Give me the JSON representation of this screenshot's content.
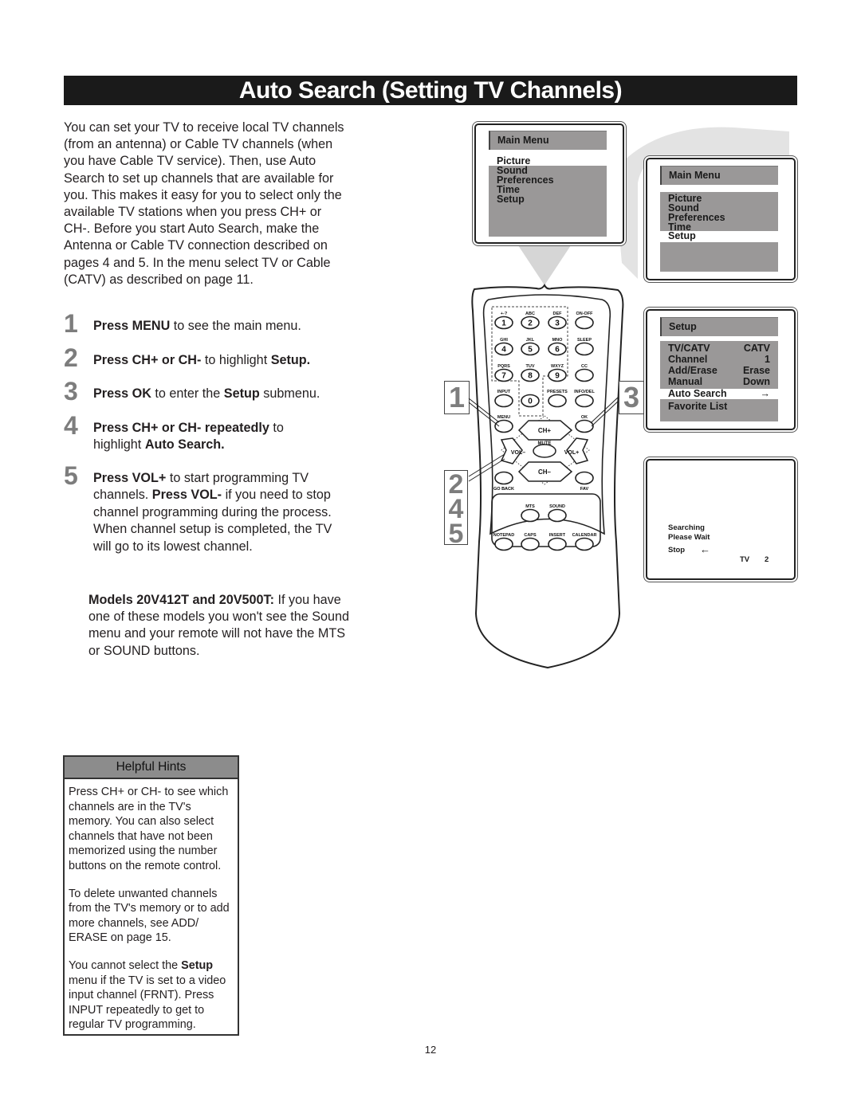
{
  "page": {
    "title": "Auto Search (Setting TV Channels)",
    "page_number": "12"
  },
  "intro": "You can set your TV to receive local TV channels (from an antenna) or Cable TV channels (when you have Cable TV service). Then, use Auto Search to set up channels that are available for you. This makes it easy for you to select only the available TV stations when you press CH+ or CH-. Before you start Auto Search, make the Antenna or Cable TV connection described on pages 4 and 5. In the menu select TV or Cable (CATV) as described on page 11.",
  "steps": [
    {
      "num": "1",
      "parts": [
        {
          "b": "Press MENU"
        },
        {
          "t": " to see the main menu."
        }
      ]
    },
    {
      "num": "2",
      "parts": [
        {
          "b": "Press CH+ or CH-"
        },
        {
          "t": " to highlight "
        },
        {
          "b": "Setup."
        }
      ]
    },
    {
      "num": "3",
      "parts": [
        {
          "b": "Press OK"
        },
        {
          "t": " to enter the "
        },
        {
          "b": "Setup"
        },
        {
          "t": " submenu."
        }
      ]
    },
    {
      "num": "4",
      "parts": [
        {
          "b": "Press CH+ or CH- repeatedly"
        },
        {
          "t": " to highlight "
        },
        {
          "b": "Auto Search."
        }
      ]
    },
    {
      "num": "5",
      "parts": [
        {
          "b": "Press VOL+"
        },
        {
          "t": " to start programming TV channels. "
        },
        {
          "b": "Press VOL-"
        },
        {
          "t": " if you need to stop channel programming during the process."
        }
      ],
      "note": "When channel setup is completed, the TV will go to its lowest channel."
    }
  ],
  "models_note": {
    "bold": "Models 20V412T and 20V500T:",
    "text": " If you have one of these models you won't see the Sound menu and your remote will not have the MTS or SOUND buttons."
  },
  "helpful_hints": {
    "heading": "Helpful Hints",
    "paragraphs": [
      [
        {
          "t": "Press CH+ or CH- to see which channels are in the TV's memory. You can also select channels that have not been memorized using the number buttons on the remote control."
        }
      ],
      [
        {
          "t": "To delete unwanted channels from the TV's memory or to add more channels, see ADD/ ERASE on page 15."
        }
      ],
      [
        {
          "t": "You cannot select the "
        },
        {
          "b": "Setup"
        },
        {
          "t": " menu if the TV is set to a video input channel (FRNT). Press INPUT repeatedly to get to regular TV programming."
        }
      ]
    ]
  },
  "screens": {
    "main_menu_1": {
      "title": "Main Menu",
      "items": [
        "Picture",
        "Sound",
        "Preferences",
        "Time",
        "Setup"
      ],
      "selected": "Picture"
    },
    "main_menu_2": {
      "title": "Main Menu",
      "items": [
        "Picture",
        "Sound",
        "Preferences",
        "Time",
        "Setup"
      ],
      "selected": "Setup"
    },
    "setup_menu": {
      "title": "Setup",
      "rows": [
        {
          "label": "TV/CATV",
          "value": "CATV"
        },
        {
          "label": "Channel",
          "value": "1"
        },
        {
          "label": "Add/Erase",
          "value": "Erase"
        },
        {
          "label": "Manual",
          "value": "Down"
        },
        {
          "label": "Auto Search",
          "value": "→"
        },
        {
          "label": "Favorite List",
          "value": ""
        }
      ],
      "selected": "Auto Search"
    },
    "searching": {
      "line1": "Searching",
      "line2": "Please Wait",
      "stop": "Stop",
      "stop_arrow": "←",
      "tv_label": "TV",
      "channel": "2"
    }
  },
  "remote": {
    "number_keys": [
      {
        "sub": "+-?",
        "label": "1"
      },
      {
        "sub": "ABC",
        "label": "2"
      },
      {
        "sub": "DEF",
        "label": "3"
      },
      {
        "sub": "GHI",
        "label": "4"
      },
      {
        "sub": "JKL",
        "label": "5"
      },
      {
        "sub": "MNO",
        "label": "6"
      },
      {
        "sub": "PQRS",
        "label": "7"
      },
      {
        "sub": "TUV",
        "label": "8"
      },
      {
        "sub": "WXYZ",
        "label": "9"
      },
      {
        "sub": "",
        "label": "0"
      }
    ],
    "side_keys": [
      "ON-OFF",
      "SLEEP",
      "CC",
      "INFO/DEL"
    ],
    "input": "INPUT",
    "presets": "PRESETS",
    "menu": "MENU",
    "ok": "OK",
    "ch_up": "CH+",
    "ch_down": "CH–",
    "vol_down": "VOL–",
    "vol_up": "VOL+",
    "mute": "MUTE",
    "go_back": "GO BACK",
    "fav": "FAV",
    "lower_keys_row1": [
      "MTS",
      "SOUND"
    ],
    "lower_keys_row2": [
      "NOTEPAD",
      "CAPS",
      "INSERT",
      "CALENDAR"
    ]
  },
  "callouts": {
    "left_top": "1",
    "right": "3",
    "left_bottom": [
      "2",
      "4",
      "5"
    ]
  }
}
